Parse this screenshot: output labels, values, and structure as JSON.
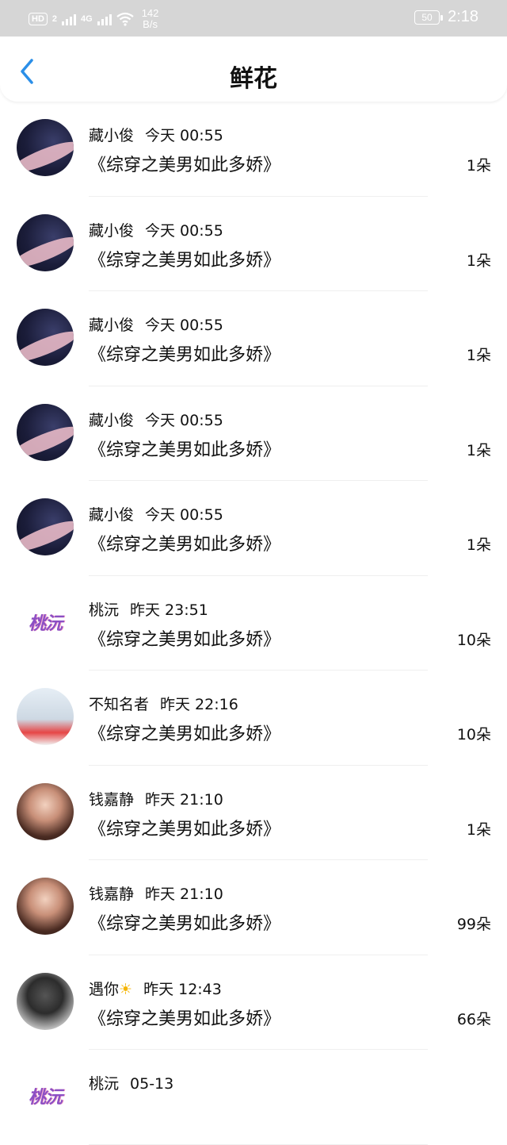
{
  "status_bar": {
    "hd_label": "HD",
    "sim_label": "2",
    "network_label": "4G",
    "speed_value": "142",
    "speed_unit": "B/s",
    "battery": "50",
    "time": "2:18"
  },
  "header": {
    "title": "鲜花"
  },
  "items": [
    {
      "name": "藏小俊",
      "time": "今天 00:55",
      "book": "《综穿之美男如此多娇》",
      "count": "1朵",
      "avatar": "dark"
    },
    {
      "name": "藏小俊",
      "time": "今天 00:55",
      "book": "《综穿之美男如此多娇》",
      "count": "1朵",
      "avatar": "dark"
    },
    {
      "name": "藏小俊",
      "time": "今天 00:55",
      "book": "《综穿之美男如此多娇》",
      "count": "1朵",
      "avatar": "dark"
    },
    {
      "name": "藏小俊",
      "time": "今天 00:55",
      "book": "《综穿之美男如此多娇》",
      "count": "1朵",
      "avatar": "dark"
    },
    {
      "name": "藏小俊",
      "time": "今天 00:55",
      "book": "《综穿之美男如此多娇》",
      "count": "1朵",
      "avatar": "dark"
    },
    {
      "name": "桃沅",
      "time": "昨天 23:51",
      "book": "《综穿之美男如此多娇》",
      "count": "10朵",
      "avatar": "logo",
      "avatar_text": "桃沅"
    },
    {
      "name": "不知名者",
      "time": "昨天 22:16",
      "book": "《综穿之美男如此多娇》",
      "count": "10朵",
      "avatar": "anime"
    },
    {
      "name": "钱嘉静",
      "time": "昨天 21:10",
      "book": "《综穿之美男如此多娇》",
      "count": "1朵",
      "avatar": "photo"
    },
    {
      "name": "钱嘉静",
      "time": "昨天 21:10",
      "book": "《综穿之美男如此多娇》",
      "count": "99朵",
      "avatar": "photo"
    },
    {
      "name": "遇你",
      "name_icon": "☀",
      "time": "昨天 12:43",
      "book": "《综穿之美男如此多娇》",
      "count": "66朵",
      "avatar": "bw"
    },
    {
      "name": "桃沅",
      "time": "05-13",
      "book": "",
      "count": "",
      "avatar": "logo",
      "avatar_text": "桃沅"
    }
  ]
}
